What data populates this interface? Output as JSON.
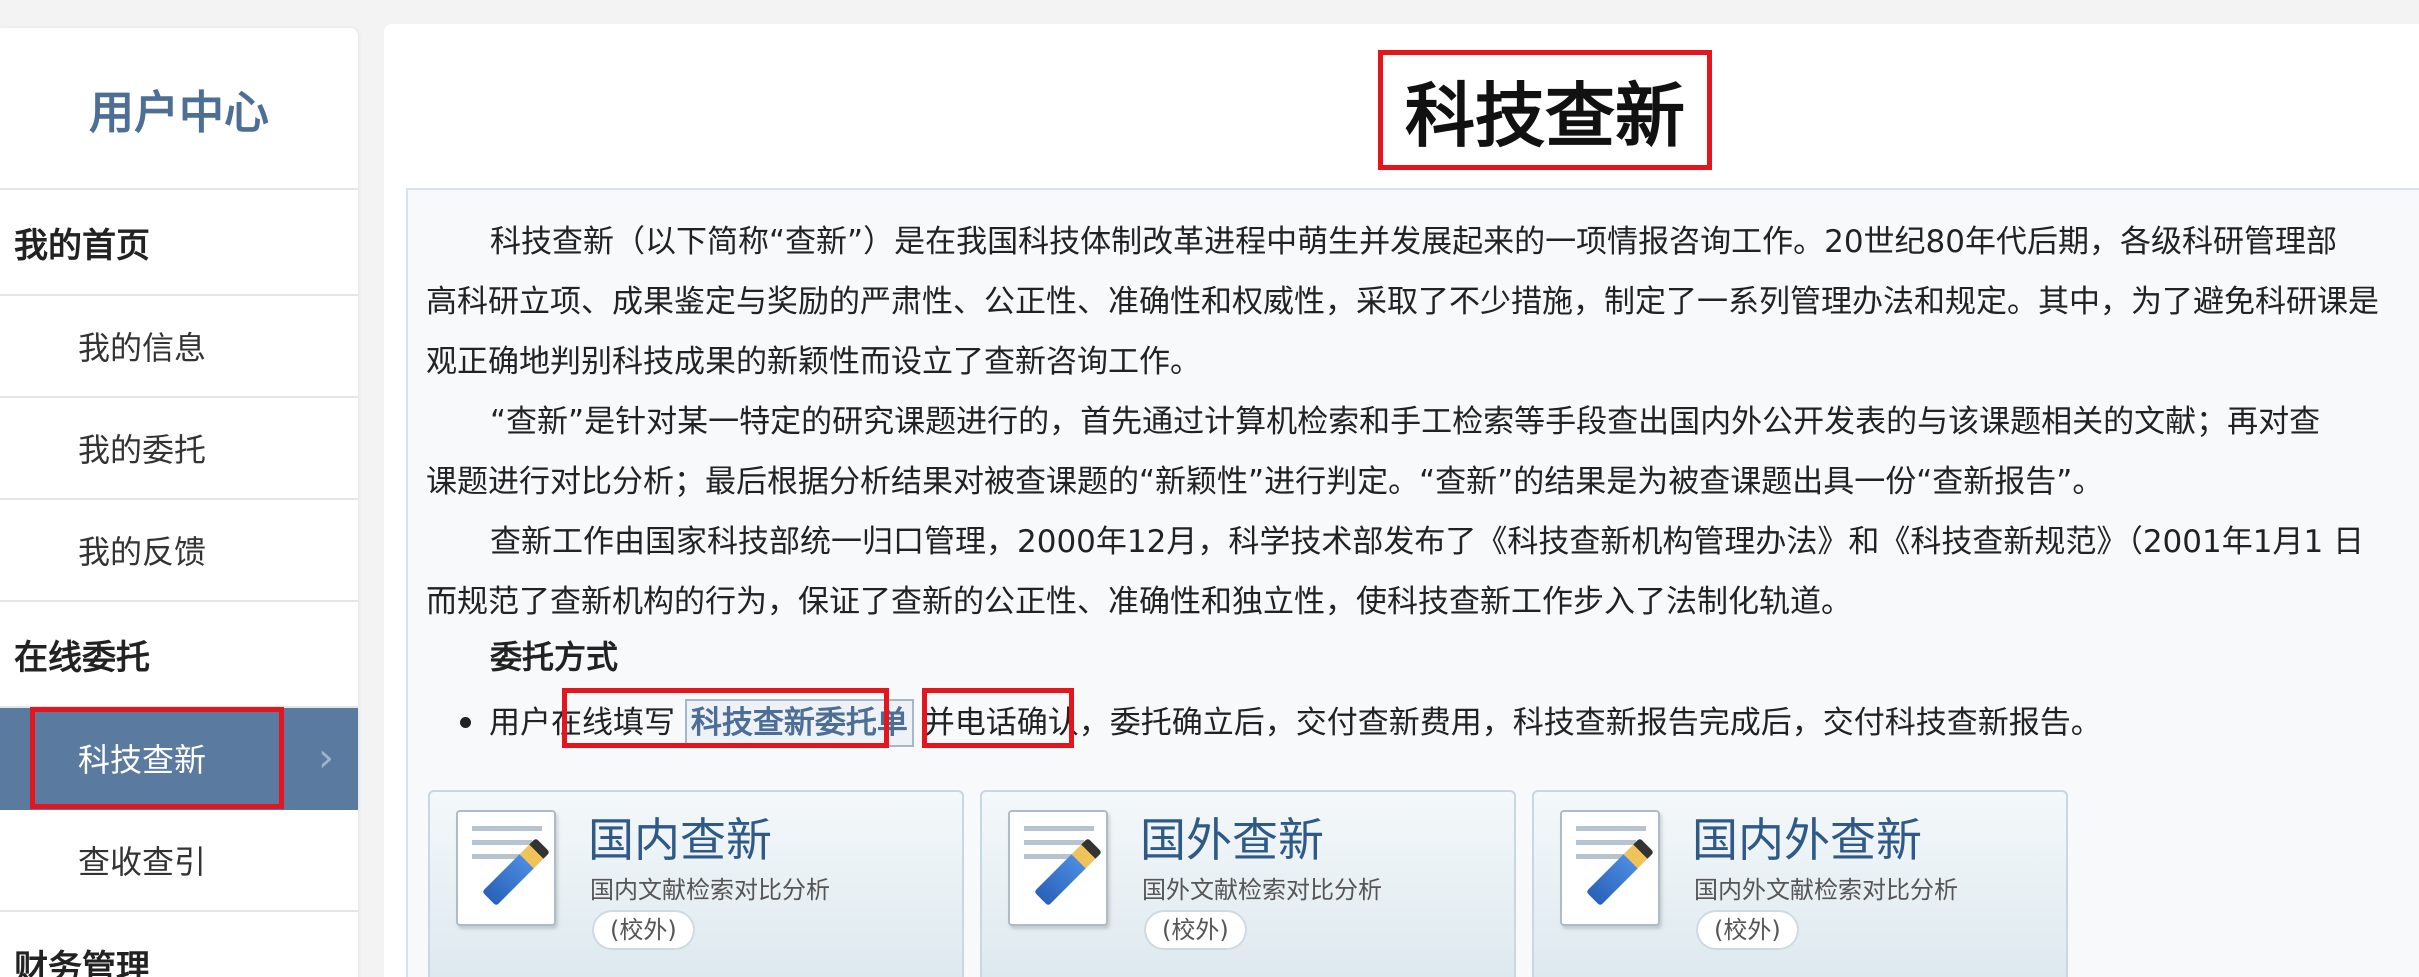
{
  "sidebar": {
    "title": "用户中心",
    "sections": [
      {
        "title": "我的首页",
        "items": [
          "我的信息",
          "我的委托",
          "我的反馈"
        ]
      },
      {
        "title": "在线委托",
        "items": [
          "科技查新",
          "查收查引"
        ]
      },
      {
        "title": "财务管理",
        "items": []
      }
    ],
    "active_item": "科技查新",
    "chevron": "›"
  },
  "main": {
    "title": "科技查新",
    "paragraphs": [
      "科技查新（以下简称“查新”）是在我国科技体制改革进程中萌生并发展起来的一项情报咨询工作。20世纪80年代后期，各级科研管理部",
      "高科研立项、成果鉴定与奖励的严肃性、公正性、准确性和权威性，采取了不少措施，制定了一系列管理办法和规定。其中，为了避免科研课是",
      "观正确地判别科技成果的新颖性而设立了查新咨询工作。",
      "“查新”是针对某一特定的研究课题进行的，首先通过计算机检索和手工检索等手段查出国内外公开发表的与该课题相关的文献；再对查",
      "课题进行对比分析；最后根据分析结果对被查课题的“新颖性”进行判定。“查新”的结果是为被查课题出具一份“查新报告”。",
      "查新工作由国家科技部统一归口管理，2000年12月，科学技术部发布了《科技查新机构管理办法》和《科技查新规范》（2001年1月1 日",
      "而规范了查新机构的行为，保证了查新的公正性、准确性和独立性，使科技查新工作步入了法制化轨道。"
    ],
    "method_heading": "委托方式",
    "method_line": {
      "prefix": "用户在线填写",
      "link": "科技查新委托单",
      "middle": "并电话确认",
      "suffix": "，委托确立后，交付查新费用，科技查新报告完成后，交付科技查新报告。"
    },
    "cards": [
      {
        "title": "国内查新",
        "subtitle": "国内文献检索对比分析",
        "badge": "(校外)"
      },
      {
        "title": "国外查新",
        "subtitle": "国外文献检索对比分析",
        "badge": "(校外)"
      },
      {
        "title": "国内外查新",
        "subtitle": "国内外文献检索对比分析",
        "badge": "(校外)"
      }
    ]
  },
  "colors": {
    "accent": "#4d6e95",
    "active_bg": "#5b7aa0",
    "highlight_box": "#e5151d"
  }
}
